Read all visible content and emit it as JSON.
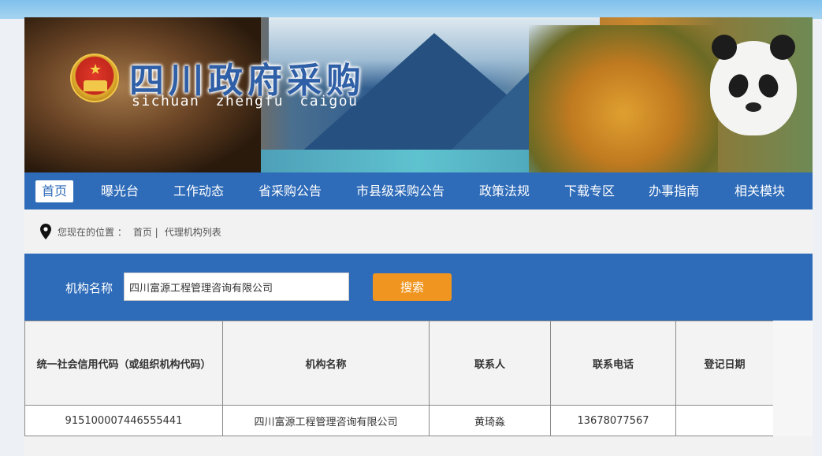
{
  "banner": {
    "title": "四川政府采购",
    "subtitle": "sichuan zhengfu caigou"
  },
  "nav": {
    "items": [
      {
        "label": "首页",
        "active": true
      },
      {
        "label": "曝光台"
      },
      {
        "label": "工作动态"
      },
      {
        "label": "省采购公告"
      },
      {
        "label": "市县级采购公告"
      },
      {
        "label": "政策法规"
      },
      {
        "label": "下载专区"
      },
      {
        "label": "办事指南"
      },
      {
        "label": "相关模块"
      }
    ]
  },
  "breadcrumb": {
    "prefix": "您现在的位置 ：",
    "home": "首页 |",
    "current": "代理机构列表"
  },
  "search": {
    "label": "机构名称",
    "value": "四川富源工程管理咨询有限公司",
    "button_label": "搜索"
  },
  "table": {
    "headers": [
      "统一社会信用代码（或组织机构代码）",
      "机构名称",
      "联系人",
      "联系电话",
      "登记日期"
    ],
    "rows": [
      [
        "915100007446555441",
        "四川富源工程管理咨询有限公司",
        "黄琦淼",
        "13678077567",
        ""
      ]
    ]
  },
  "colors": {
    "nav_blue": "#2e6bb8",
    "button_orange": "#f0951f",
    "title_blue": "#2f5fa6"
  }
}
